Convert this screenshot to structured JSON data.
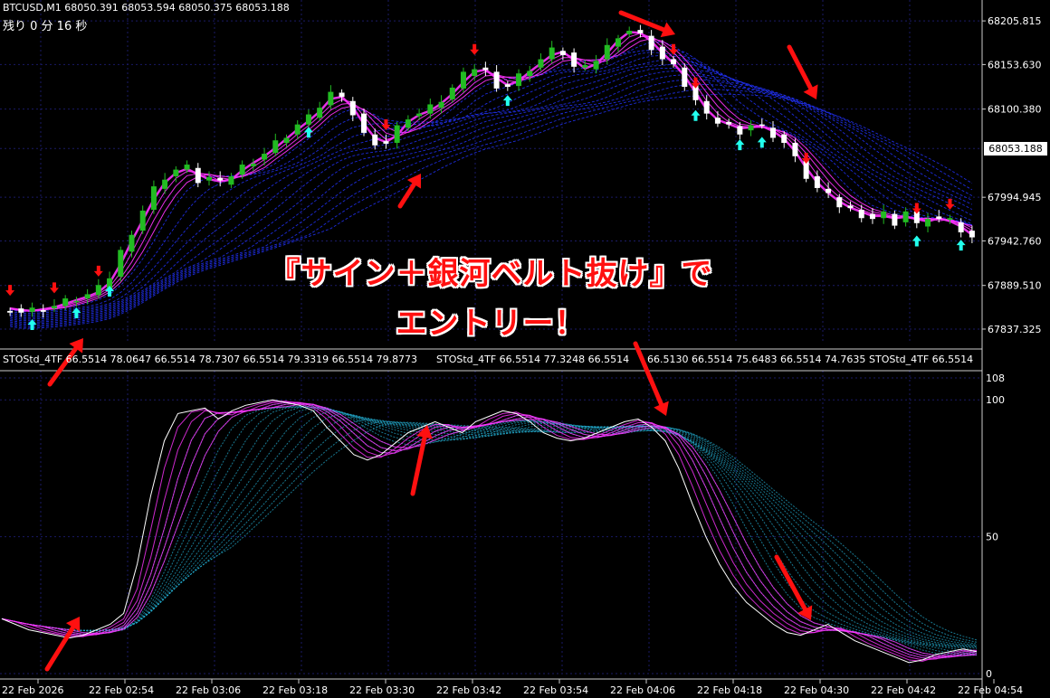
{
  "header": {
    "symbol_line": "BTCUSD,M1  68050.391 68053.594 68050.375 68053.188",
    "remaining": "残り 0 分 16 秒",
    "sub_label_repeat": [
      "STOStd_4TF 66.5514 78.0647 66.5514 78.7307 66.5514 79.3319 66.5514 79.8773",
      "STOStd_4TF 66.5514 77.3248 66.5514",
      "66.5130 66.5514 75.6483 66.5514 74.7635",
      "STOStd_4TF 66.5514"
    ]
  },
  "overlay": {
    "line1": "『サイン＋銀河ベルト抜け』で",
    "line2": "エントリー！"
  },
  "colors": {
    "bg": "#000000",
    "grid": "#1a1a66",
    "bull": "#22bb22",
    "bear": "#ffffff",
    "magenta": "#ff33ff",
    "ribbon": "#2233ff",
    "osc_ribbon": "#22aacc",
    "arrow": "#ff1010",
    "up_sign": "#22ffee",
    "down_sign": "#ff1010"
  },
  "chart_data": [
    {
      "type": "candlestick",
      "title": "BTCUSD,M1",
      "current_price": "68053.188",
      "y_ticks": [
        "68205.815",
        "68153.630",
        "68100.380",
        "68053.188",
        "67994.945",
        "67942.760",
        "67889.510",
        "67837.325"
      ],
      "ylim": [
        67820,
        68220
      ],
      "close_path": [
        67862,
        67858,
        67860,
        67862,
        67865,
        67870,
        67874,
        67878,
        67885,
        67900,
        67930,
        67955,
        67980,
        68005,
        68020,
        68028,
        68030,
        68015,
        68018,
        68010,
        68022,
        68032,
        68040,
        68048,
        68060,
        68070,
        68082,
        68090,
        68105,
        68120,
        68110,
        68095,
        68070,
        68062,
        68060,
        68078,
        68092,
        68095,
        68102,
        68112,
        68125,
        68140,
        68150,
        68145,
        68130,
        68128,
        68140,
        68150,
        68160,
        68170,
        68168,
        68150,
        68148,
        68160,
        68175,
        68190,
        68195,
        68188,
        68175,
        68160,
        68150,
        68130,
        68110,
        68090,
        68085,
        68080,
        68075,
        68082,
        68078,
        68070,
        68060,
        68040,
        68020,
        68005,
        67995,
        67985,
        67980,
        67975,
        67970,
        67975,
        67965,
        67978,
        67960,
        67972,
        67968,
        67965,
        67955,
        67945
      ],
      "up_signs_at": [
        2,
        6,
        9,
        27,
        45,
        62,
        66,
        68,
        82,
        86
      ],
      "down_signs_at": [
        0,
        4,
        8,
        34,
        42,
        60,
        62,
        72,
        82,
        85
      ]
    },
    {
      "type": "line",
      "title": "STOStd_4TF",
      "y_ticks": [
        "108",
        "100",
        "50",
        "0"
      ],
      "ylim": [
        0,
        108
      ],
      "x_tick_labels": [
        "22 Feb 2026",
        "22 Feb 02:54",
        "22 Feb 03:06",
        "22 Feb 03:18",
        "22 Feb 03:30",
        "22 Feb 03:42",
        "22 Feb 03:54",
        "22 Feb 04:06",
        "22 Feb 04:18",
        "22 Feb 04:30",
        "22 Feb 04:42",
        "22 Feb 04:54"
      ],
      "main_path": [
        20,
        18,
        16,
        15,
        14,
        13,
        14,
        16,
        18,
        22,
        40,
        65,
        85,
        95,
        96,
        97,
        93,
        96,
        98,
        99,
        100,
        99,
        98,
        96,
        90,
        85,
        80,
        78,
        80,
        84,
        88,
        90,
        92,
        90,
        88,
        92,
        94,
        96,
        95,
        92,
        88,
        86,
        85,
        86,
        88,
        90,
        92,
        93,
        90,
        85,
        75,
        62,
        50,
        40,
        32,
        26,
        22,
        18,
        15,
        14,
        16,
        18,
        15,
        12,
        10,
        8,
        6,
        4,
        5,
        7,
        8,
        9,
        8
      ]
    }
  ]
}
